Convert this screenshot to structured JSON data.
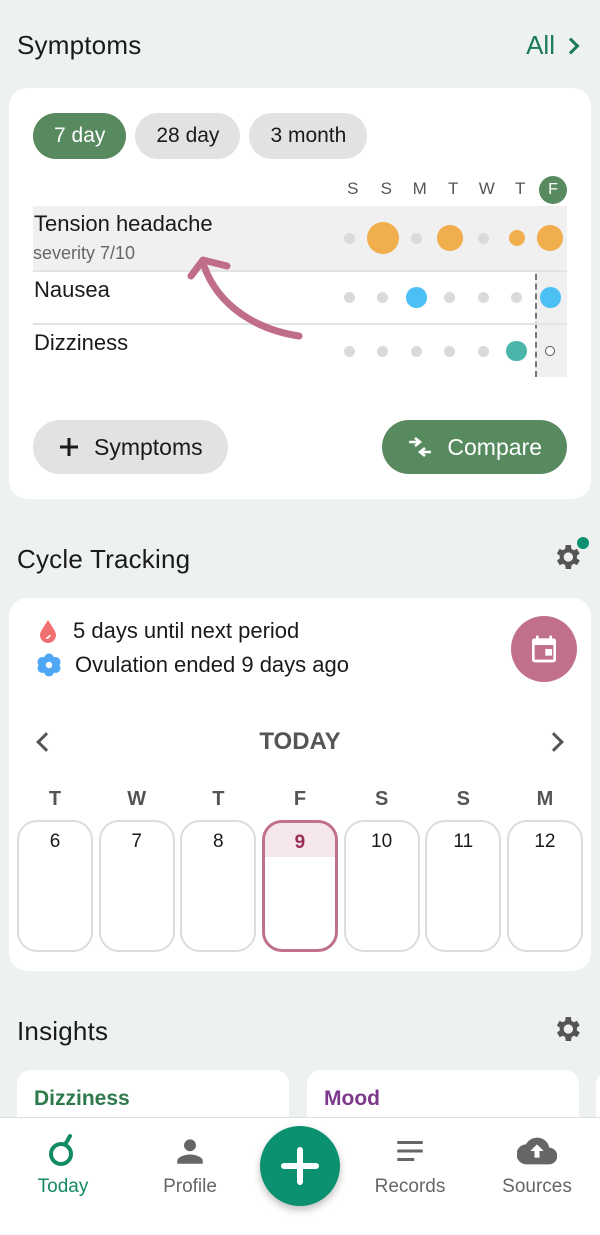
{
  "symptoms": {
    "title": "Symptoms",
    "all_label": "All",
    "ranges": [
      "7 day",
      "28 day",
      "3 month"
    ],
    "active_range": "7 day",
    "days": [
      "S",
      "S",
      "M",
      "T",
      "W",
      "T",
      "F"
    ],
    "today_index": 6,
    "rows": [
      {
        "name": "Tension headache",
        "subtitle": "severity 7/10",
        "color": "#f0ae4c",
        "highlighted": true,
        "entries": [
          0,
          2,
          0,
          1.6,
          0,
          1,
          1.6
        ]
      },
      {
        "name": "Nausea",
        "subtitle": "",
        "color": "#4cc0f5",
        "highlighted": false,
        "entries": [
          0,
          0,
          1.3,
          0,
          0,
          0,
          1.3
        ]
      },
      {
        "name": "Dizziness",
        "subtitle": "",
        "color": "#4ab6aa",
        "highlighted": false,
        "entries": [
          0,
          0,
          0,
          0,
          0,
          1.3,
          -1
        ]
      }
    ],
    "add_button": "Symptoms",
    "compare_button": "Compare"
  },
  "cycle": {
    "title": "Cycle Tracking",
    "next_period": "5 days until next period",
    "ovulation": "Ovulation ended 9 days ago",
    "week_title": "TODAY",
    "week": [
      {
        "label": "T",
        "num": "6"
      },
      {
        "label": "W",
        "num": "7"
      },
      {
        "label": "T",
        "num": "8"
      },
      {
        "label": "F",
        "num": "9",
        "today": true
      },
      {
        "label": "S",
        "num": "10"
      },
      {
        "label": "S",
        "num": "11"
      },
      {
        "label": "M",
        "num": "12"
      }
    ]
  },
  "insights": {
    "title": "Insights",
    "cards": [
      {
        "title": "Dizziness",
        "color": "#2e7a4c"
      },
      {
        "title": "Mood",
        "color": "#7d3a8c"
      }
    ]
  },
  "nav": {
    "items": [
      {
        "label": "Today",
        "icon": "today-icon",
        "active": true
      },
      {
        "label": "Profile",
        "icon": "person-icon"
      },
      {
        "label": "Records",
        "icon": "records-icon"
      },
      {
        "label": "Sources",
        "icon": "cloud-upload-icon"
      }
    ]
  }
}
